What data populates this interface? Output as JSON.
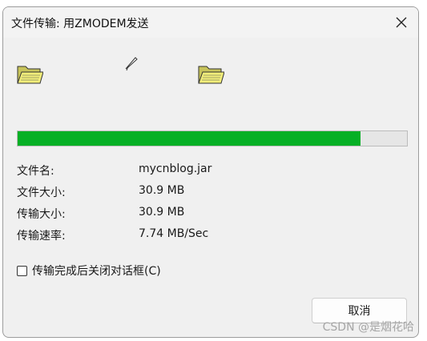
{
  "window": {
    "title": "文件传输: 用ZMODEM发送"
  },
  "progress": {
    "fraction": 0.88
  },
  "info": {
    "rows": [
      {
        "label": "文件名:",
        "value": "mycnblog.jar"
      },
      {
        "label": "文件大小:",
        "value": "30.9 MB"
      },
      {
        "label": "传输大小:",
        "value": "30.9 MB"
      },
      {
        "label": "传输速率:",
        "value": "7.74 MB/Sec"
      }
    ]
  },
  "options": {
    "close_on_complete_label": "传输完成后关闭对话框(C)",
    "close_on_complete_checked": false
  },
  "buttons": {
    "cancel_label": "取消"
  },
  "watermark": "CSDN @是烟花哈",
  "icons": {
    "source": "folder-icon",
    "destination": "folder-icon",
    "transfer": "paper-airplane-icon",
    "close": "close-icon"
  },
  "colors": {
    "progress_fill": "#06b025",
    "folder_fill": "#f2ee7a"
  }
}
